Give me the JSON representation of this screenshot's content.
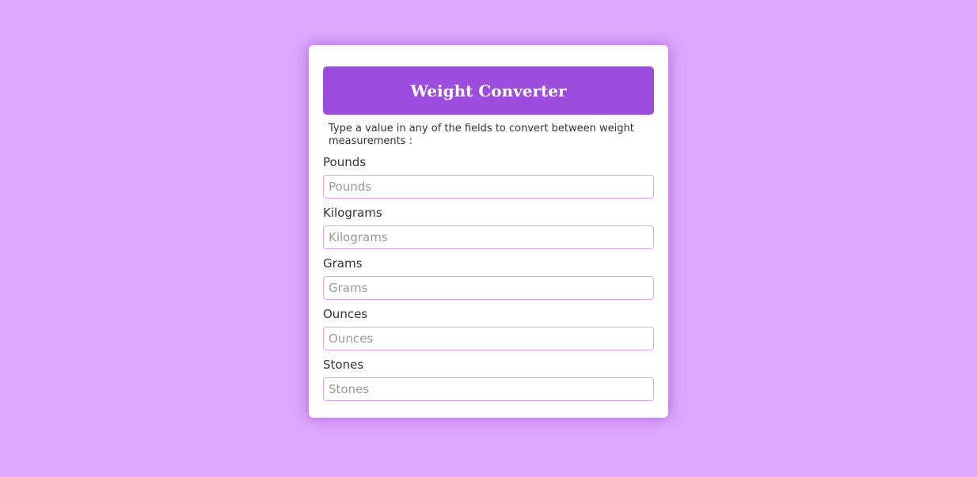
{
  "app": {
    "title": "Weight Converter",
    "instructions": "Type a value in any of the fields to convert between weight measurements :"
  },
  "fields": [
    {
      "label": "Pounds",
      "placeholder": "Pounds",
      "value": ""
    },
    {
      "label": "Kilograms",
      "placeholder": "Kilograms",
      "value": ""
    },
    {
      "label": "Grams",
      "placeholder": "Grams",
      "value": ""
    },
    {
      "label": "Ounces",
      "placeholder": "Ounces",
      "value": ""
    },
    {
      "label": "Stones",
      "placeholder": "Stones",
      "value": ""
    }
  ],
  "colors": {
    "page_background": "#dda8fc",
    "header_background": "#9c4ddd",
    "input_border": "#dba4f7"
  }
}
